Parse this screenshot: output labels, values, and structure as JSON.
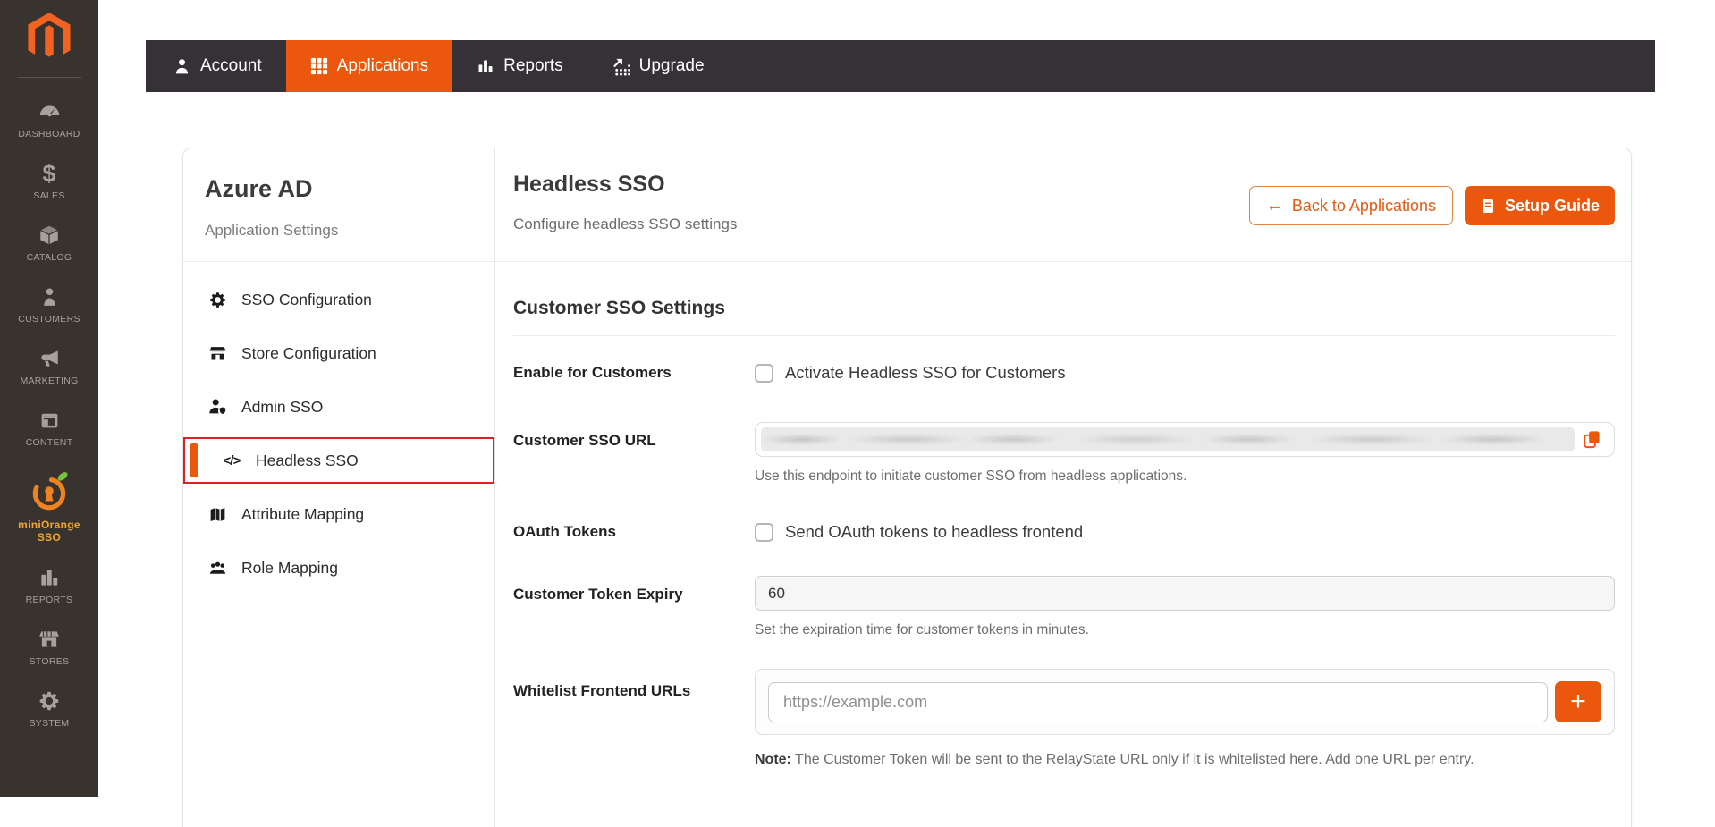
{
  "colors": {
    "accent": "#ea570d",
    "magento_orange": "#f26322",
    "highlight_red": "#e02020",
    "sidebar_bg": "#38332f",
    "nav_bg": "#353136",
    "minionge_label": "#f0a52e",
    "leaf_green": "#7ac143"
  },
  "icons": {
    "code": "</>",
    "back_arrow": "←"
  },
  "magento_sidebar": {
    "items": [
      {
        "label": "DASHBOARD"
      },
      {
        "label": "SALES"
      },
      {
        "label": "CATALOG"
      },
      {
        "label": "CUSTOMERS"
      },
      {
        "label": "MARKETING"
      },
      {
        "label": "CONTENT"
      },
      {
        "label": "miniOrange SSO"
      },
      {
        "label": "REPORTS"
      },
      {
        "label": "STORES"
      },
      {
        "label": "SYSTEM"
      }
    ]
  },
  "top_nav": {
    "tabs": [
      {
        "label": "Account"
      },
      {
        "label": "Applications",
        "active": true
      },
      {
        "label": "Reports"
      },
      {
        "label": "Upgrade"
      }
    ]
  },
  "app_panel": {
    "title": "Azure AD",
    "subtitle": "Application Settings",
    "menu": [
      {
        "label": "SSO Configuration"
      },
      {
        "label": "Store Configuration"
      },
      {
        "label": "Admin SSO"
      },
      {
        "label": "Headless SSO",
        "active": true
      },
      {
        "label": "Attribute Mapping"
      },
      {
        "label": "Role Mapping"
      }
    ]
  },
  "content": {
    "title": "Headless SSO",
    "subtitle": "Configure headless SSO settings",
    "back_button_label": "Back to Applications",
    "setup_button_label": "Setup Guide",
    "section_title": "Customer SSO Settings",
    "enable_row": {
      "label": "Enable for Customers",
      "checkbox_label": "Activate Headless SSO for Customers",
      "checked": false
    },
    "sso_url_row": {
      "label": "Customer SSO URL",
      "value": "",
      "redacted": true,
      "helper": "Use this endpoint to initiate customer SSO from headless applications."
    },
    "oauth_row": {
      "label": "OAuth Tokens",
      "checkbox_label": "Send OAuth tokens to headless frontend",
      "checked": false
    },
    "expiry_row": {
      "label": "Customer Token Expiry",
      "value": "60",
      "helper": "Set the expiration time for customer tokens in minutes."
    },
    "whitelist_row": {
      "label": "Whitelist Frontend URLs",
      "placeholder": "https://example.com",
      "add_button_label": "+",
      "note_label": "Note:",
      "note_text": " The Customer Token will be sent to the RelayState URL only if it is whitelisted here. Add one URL per entry."
    }
  }
}
